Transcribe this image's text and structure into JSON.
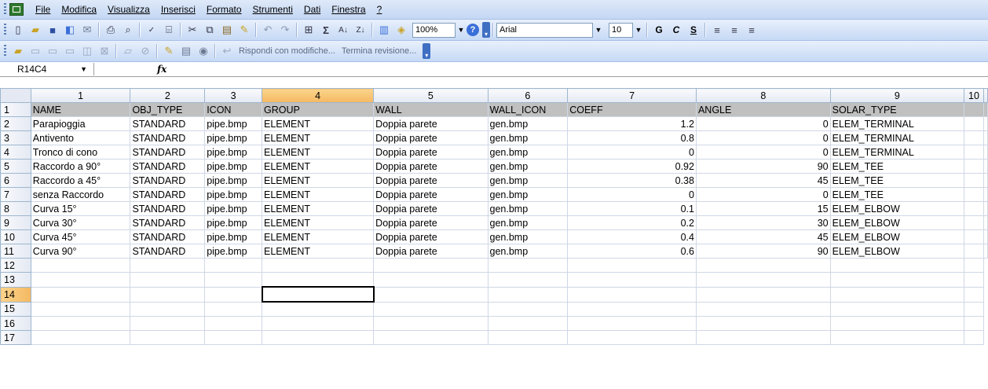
{
  "menu": [
    "File",
    "Modifica",
    "Visualizza",
    "Inserisci",
    "Formato",
    "Strumenti",
    "Dati",
    "Finestra",
    "?"
  ],
  "toolbar": {
    "zoom": "100%",
    "font": "Arial",
    "font_size": "10",
    "bold": "G",
    "italic": "C",
    "underline": "S"
  },
  "review_toolbar": {
    "reply": "Rispondi con modifiche...",
    "end_review": "Termina revisione..."
  },
  "formula_bar": {
    "name_box": "R14C4",
    "fx": "fx",
    "value": ""
  },
  "sheet": {
    "columns": [
      "1",
      "2",
      "3",
      "4",
      "5",
      "6",
      "7",
      "8",
      "9",
      "10"
    ],
    "selected_column": 3,
    "selected_row": 14,
    "header": [
      "NAME",
      "OBJ_TYPE",
      "ICON",
      "GROUP",
      "WALL",
      "WALL_ICON",
      "COEFF",
      "ANGLE",
      "SOLAR_TYPE",
      ""
    ],
    "rows": [
      [
        "Parapioggia",
        "STANDARD",
        "pipe.bmp",
        "ELEMENT",
        "Doppia parete",
        "gen.bmp",
        "1.2",
        "0",
        "ELEM_TERMINAL"
      ],
      [
        "Antivento",
        "STANDARD",
        "pipe.bmp",
        "ELEMENT",
        "Doppia parete",
        "gen.bmp",
        "0.8",
        "0",
        "ELEM_TERMINAL"
      ],
      [
        "Tronco di cono",
        "STANDARD",
        "pipe.bmp",
        "ELEMENT",
        "Doppia parete",
        "gen.bmp",
        "0",
        "0",
        "ELEM_TERMINAL"
      ],
      [
        "Raccordo a 90°",
        "STANDARD",
        "pipe.bmp",
        "ELEMENT",
        "Doppia parete",
        "gen.bmp",
        "0.92",
        "90",
        "ELEM_TEE"
      ],
      [
        "Raccordo a 45°",
        "STANDARD",
        "pipe.bmp",
        "ELEMENT",
        "Doppia parete",
        "gen.bmp",
        "0.38",
        "45",
        "ELEM_TEE"
      ],
      [
        "senza Raccordo",
        "STANDARD",
        "pipe.bmp",
        "ELEMENT",
        "Doppia parete",
        "gen.bmp",
        "0",
        "0",
        "ELEM_TEE"
      ],
      [
        "Curva 15°",
        "STANDARD",
        "pipe.bmp",
        "ELEMENT",
        "Doppia parete",
        "gen.bmp",
        "0.1",
        "15",
        "ELEM_ELBOW"
      ],
      [
        "Curva 30°",
        "STANDARD",
        "pipe.bmp",
        "ELEMENT",
        "Doppia parete",
        "gen.bmp",
        "0.2",
        "30",
        "ELEM_ELBOW"
      ],
      [
        "Curva 45°",
        "STANDARD",
        "pipe.bmp",
        "ELEMENT",
        "Doppia parete",
        "gen.bmp",
        "0.4",
        "45",
        "ELEM_ELBOW"
      ],
      [
        "Curva 90°",
        "STANDARD",
        "pipe.bmp",
        "ELEMENT",
        "Doppia parete",
        "gen.bmp",
        "0.6",
        "90",
        "ELEM_ELBOW"
      ]
    ],
    "empty_rows": [
      "12",
      "13",
      "14",
      "15",
      "16",
      "17"
    ]
  }
}
